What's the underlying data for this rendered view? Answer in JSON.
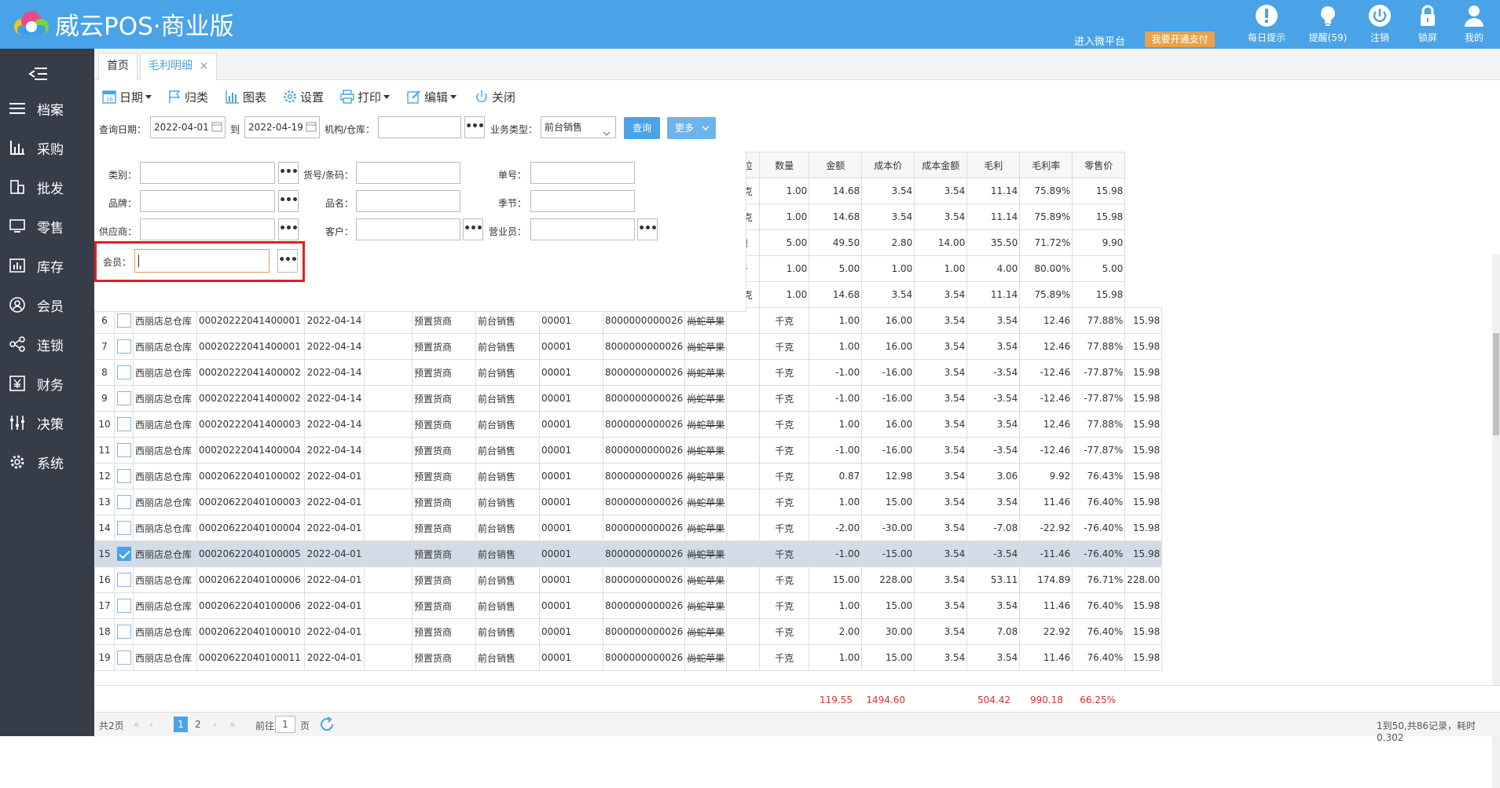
{
  "app": {
    "title": "威云POS·商业版",
    "platform_link": "进入微平台",
    "pay_button": "我要开通支付",
    "top_icons": [
      {
        "label": "每日提示",
        "icon": "exclamation-icon"
      },
      {
        "label": "提醒(59)",
        "icon": "lightbulb-icon"
      },
      {
        "label": "注销",
        "icon": "power-icon"
      },
      {
        "label": "锁屏",
        "icon": "lock-icon"
      },
      {
        "label": "我的",
        "icon": "user-icon"
      }
    ],
    "colors": {
      "primary": "#4aa3e6",
      "sidebar": "#363c48",
      "highlight": "#e02020"
    }
  },
  "sidebar": {
    "items": [
      {
        "label": "档案",
        "icon": "list-icon"
      },
      {
        "label": "采购",
        "icon": "bar-chart-icon"
      },
      {
        "label": "批发",
        "icon": "building-icon"
      },
      {
        "label": "零售",
        "icon": "monitor-icon"
      },
      {
        "label": "库存",
        "icon": "stock-icon"
      },
      {
        "label": "会员",
        "icon": "member-icon"
      },
      {
        "label": "连锁",
        "icon": "share-icon"
      },
      {
        "label": "财务",
        "icon": "yen-icon"
      },
      {
        "label": "决策",
        "icon": "sliders-icon"
      },
      {
        "label": "系统",
        "icon": "gear-icon"
      }
    ]
  },
  "tabs": {
    "home": "首页",
    "active": "毛利明细",
    "close": "×"
  },
  "toolbar": {
    "date": "日期",
    "categorize": "归类",
    "chart": "图表",
    "settings": "设置",
    "print": "打印",
    "edit": "编辑",
    "close": "关闭"
  },
  "query": {
    "date_label": "查询日期：",
    "date_from": "2022-04-01",
    "to_label": "到",
    "date_to": "2022-04-19",
    "org_label": "机构/仓库：",
    "biz_label": "业务类型：",
    "biz_value": "前台销售",
    "search_btn": "查询",
    "more_btn": "更多"
  },
  "filter": {
    "category": "类别：",
    "sku": "货号/条码：",
    "order_no": "单号：",
    "brand": "品牌：",
    "product_name": "品名：",
    "season": "季节：",
    "supplier": "供应商：",
    "customer": "客户：",
    "salesperson": "营业员：",
    "member": "会员："
  },
  "table": {
    "right_headers": [
      "单位",
      "数量",
      "金额",
      "成本价",
      "成本金额",
      "毛利",
      "毛利率",
      "零售价"
    ],
    "top_rows": [
      [
        "千克",
        "1.00",
        "14.68",
        "3.54",
        "3.54",
        "11.14",
        "75.89%",
        "15.98"
      ],
      [
        "千克",
        "1.00",
        "14.68",
        "3.54",
        "3.54",
        "11.14",
        "75.89%",
        "15.98"
      ],
      [
        "把",
        "5.00",
        "49.50",
        "2.80",
        "14.00",
        "35.50",
        "71.72%",
        "9.90"
      ],
      [
        "个",
        "1.00",
        "5.00",
        "1.00",
        "1.00",
        "4.00",
        "80.00%",
        "5.00"
      ],
      [
        "千克",
        "1.00",
        "14.68",
        "3.54",
        "3.54",
        "11.14",
        "75.89%",
        "15.98"
      ]
    ],
    "rows": [
      [
        "6",
        "西丽店总仓库",
        "00020222041400001",
        "2022-04-14",
        "预置货商",
        "前台销售",
        "00001",
        "8000000000026",
        "尚蛇苹果",
        "千克",
        "1.00",
        "16.00",
        "3.54",
        "3.54",
        "12.46",
        "77.88%",
        "15.98"
      ],
      [
        "7",
        "西丽店总仓库",
        "00020222041400001",
        "2022-04-14",
        "预置货商",
        "前台销售",
        "00001",
        "8000000000026",
        "尚蛇苹果",
        "千克",
        "1.00",
        "16.00",
        "3.54",
        "3.54",
        "12.46",
        "77.88%",
        "15.98"
      ],
      [
        "8",
        "西丽店总仓库",
        "00020222041400002",
        "2022-04-14",
        "预置货商",
        "前台销售",
        "00001",
        "8000000000026",
        "尚蛇苹果",
        "千克",
        "-1.00",
        "-16.00",
        "3.54",
        "-3.54",
        "-12.46",
        "-77.87%",
        "15.98"
      ],
      [
        "9",
        "西丽店总仓库",
        "00020222041400002",
        "2022-04-14",
        "预置货商",
        "前台销售",
        "00001",
        "8000000000026",
        "尚蛇苹果",
        "千克",
        "-1.00",
        "-16.00",
        "3.54",
        "-3.54",
        "-12.46",
        "-77.87%",
        "15.98"
      ],
      [
        "10",
        "西丽店总仓库",
        "00020222041400003",
        "2022-04-14",
        "预置货商",
        "前台销售",
        "00001",
        "8000000000026",
        "尚蛇苹果",
        "千克",
        "1.00",
        "16.00",
        "3.54",
        "3.54",
        "12.46",
        "77.88%",
        "15.98"
      ],
      [
        "11",
        "西丽店总仓库",
        "00020222041400004",
        "2022-04-14",
        "预置货商",
        "前台销售",
        "00001",
        "8000000000026",
        "尚蛇苹果",
        "千克",
        "-1.00",
        "-16.00",
        "3.54",
        "-3.54",
        "-12.46",
        "-77.87%",
        "15.98"
      ],
      [
        "12",
        "西丽店总仓库",
        "00020622040100002",
        "2022-04-01",
        "预置货商",
        "前台销售",
        "00001",
        "8000000000026",
        "尚蛇苹果",
        "千克",
        "0.87",
        "12.98",
        "3.54",
        "3.06",
        "9.92",
        "76.43%",
        "15.98"
      ],
      [
        "13",
        "西丽店总仓库",
        "00020622040100003",
        "2022-04-01",
        "预置货商",
        "前台销售",
        "00001",
        "8000000000026",
        "尚蛇苹果",
        "千克",
        "1.00",
        "15.00",
        "3.54",
        "3.54",
        "11.46",
        "76.40%",
        "15.98"
      ],
      [
        "14",
        "西丽店总仓库",
        "00020622040100004",
        "2022-04-01",
        "预置货商",
        "前台销售",
        "00001",
        "8000000000026",
        "尚蛇苹果",
        "千克",
        "-2.00",
        "-30.00",
        "3.54",
        "-7.08",
        "-22.92",
        "-76.40%",
        "15.98"
      ],
      [
        "15",
        "西丽店总仓库",
        "00020622040100005",
        "2022-04-01",
        "预置货商",
        "前台销售",
        "00001",
        "8000000000026",
        "尚蛇苹果",
        "千克",
        "-1.00",
        "-15.00",
        "3.54",
        "-3.54",
        "-11.46",
        "-76.40%",
        "15.98"
      ],
      [
        "16",
        "西丽店总仓库",
        "00020622040100006",
        "2022-04-01",
        "预置货商",
        "前台销售",
        "00001",
        "8000000000026",
        "尚蛇苹果",
        "千克",
        "15.00",
        "228.00",
        "3.54",
        "53.11",
        "174.89",
        "76.71%",
        "228.00"
      ],
      [
        "17",
        "西丽店总仓库",
        "00020622040100006",
        "2022-04-01",
        "预置货商",
        "前台销售",
        "00001",
        "8000000000026",
        "尚蛇苹果",
        "千克",
        "1.00",
        "15.00",
        "3.54",
        "3.54",
        "11.46",
        "76.40%",
        "15.98"
      ],
      [
        "18",
        "西丽店总仓库",
        "00020622040100010",
        "2022-04-01",
        "预置货商",
        "前台销售",
        "00001",
        "8000000000026",
        "尚蛇苹果",
        "千克",
        "2.00",
        "30.00",
        "3.54",
        "7.08",
        "22.92",
        "76.40%",
        "15.98"
      ],
      [
        "19",
        "西丽店总仓库",
        "00020622040100011",
        "2022-04-01",
        "预置货商",
        "前台销售",
        "00001",
        "8000000000026",
        "尚蛇苹果",
        "千克",
        "1.00",
        "15.00",
        "3.54",
        "3.54",
        "11.46",
        "76.40%",
        "15.98"
      ]
    ],
    "selected_row": "15",
    "totals": {
      "qty": "119.55",
      "amount": "1494.60",
      "cost_amount": "504.42",
      "profit": "990.18",
      "margin": "66.25%"
    }
  },
  "pager": {
    "total_pages": "共2页",
    "page1": "1",
    "page2": "2",
    "goto": "前往",
    "goto_value": "1",
    "page_unit": "页",
    "summary": "1到50,共86记录，耗时 0.302"
  }
}
